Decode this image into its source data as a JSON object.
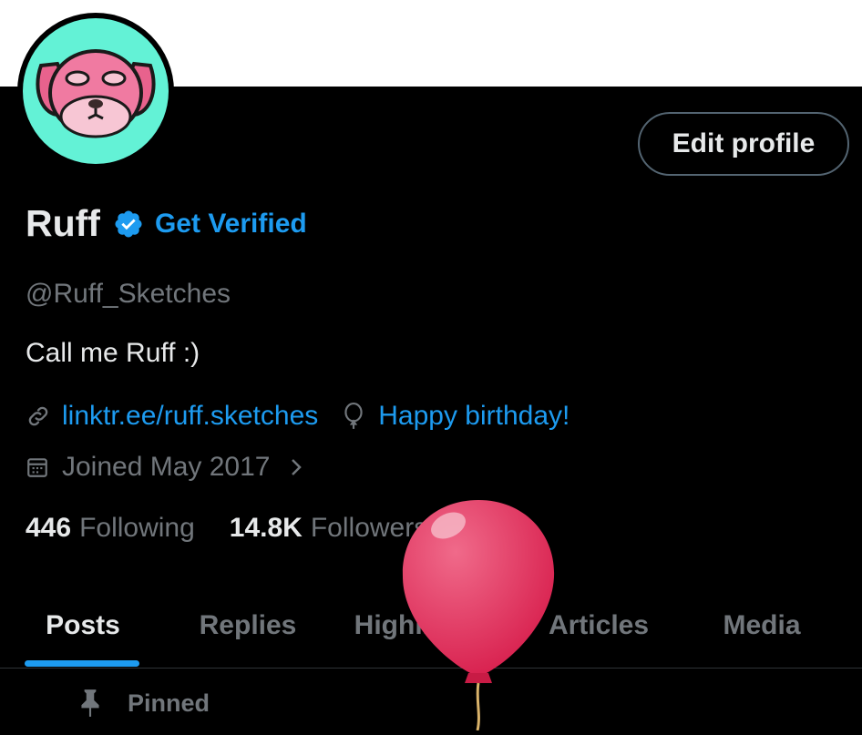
{
  "profile": {
    "display_name": "Ruff",
    "get_verified_label": "Get Verified",
    "handle": "@Ruff_Sketches",
    "bio": "Call me Ruff :)",
    "website": "linktr.ee/ruff.sketches",
    "birthday_text": "Happy birthday!",
    "joined": "Joined May 2017",
    "following_count": "446",
    "following_label": "Following",
    "followers_count": "14.8K",
    "followers_label": "Followers"
  },
  "header": {
    "edit_profile_label": "Edit profile"
  },
  "tabs": [
    {
      "label": "Posts",
      "active": true
    },
    {
      "label": "Replies",
      "active": false
    },
    {
      "label": "Highlights",
      "active": false
    },
    {
      "label": "Articles",
      "active": false
    },
    {
      "label": "Media",
      "active": false
    }
  ],
  "pinned": {
    "label": "Pinned"
  },
  "colors": {
    "background": "#000000",
    "accent": "#1d9bf0",
    "text_primary": "#e7e9ea",
    "text_secondary": "#71767b",
    "avatar_bg": "#63f2d6",
    "balloon": "#e0355d"
  },
  "icons": [
    "verified-badge-icon",
    "link-icon",
    "balloon-icon",
    "calendar-icon",
    "chevron-right-icon",
    "pin-icon"
  ]
}
